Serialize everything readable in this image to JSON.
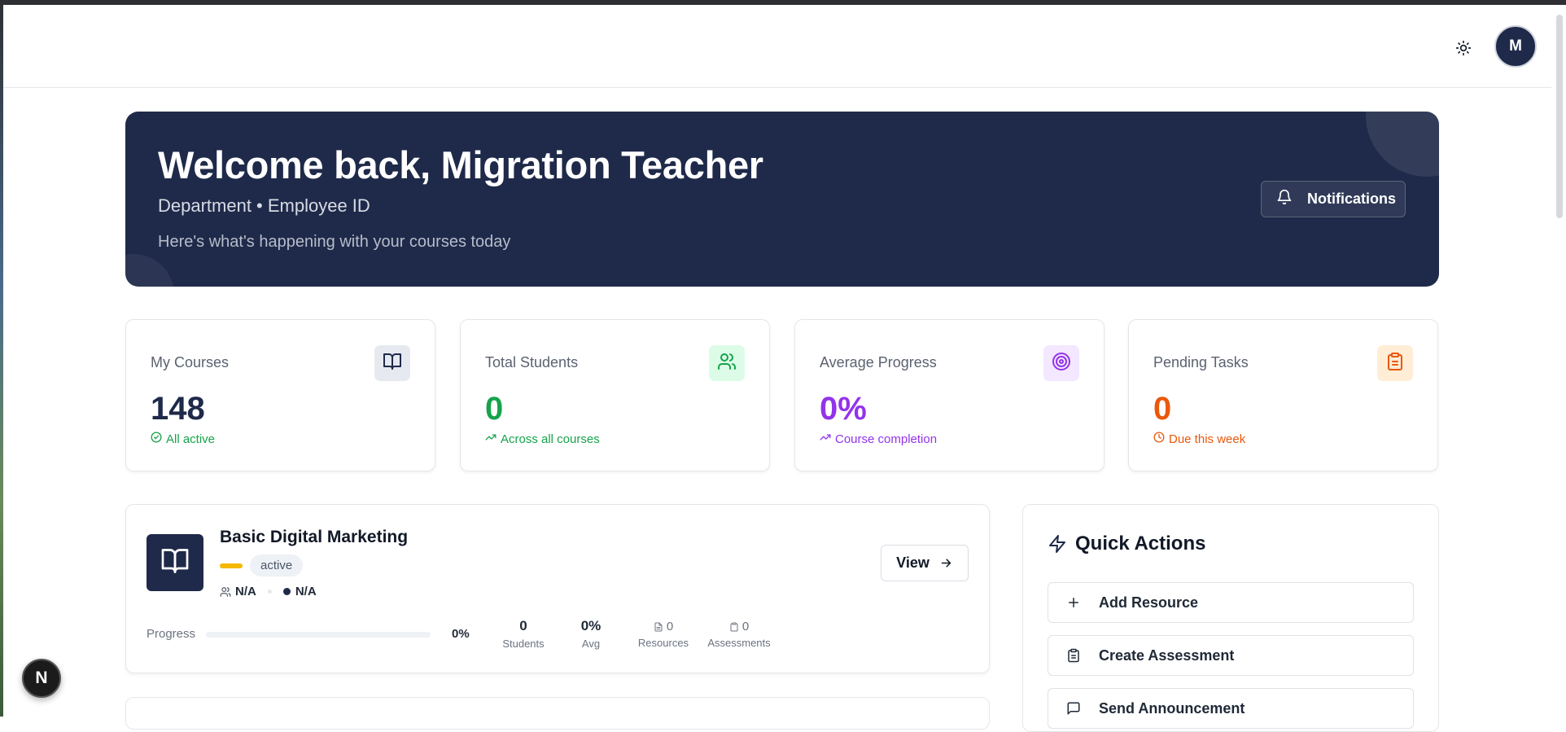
{
  "header": {
    "theme_icon": "sun-icon",
    "avatar_initial": "M"
  },
  "hero": {
    "title": "Welcome back, Migration Teacher",
    "subtitle": "Department • Employee ID",
    "tagline": "Here's what's happening with your courses today",
    "notifications_label": "Notifications",
    "colors": {
      "background": "#1f2a4a"
    }
  },
  "stats": [
    {
      "label": "My Courses",
      "value": "148",
      "note": "All active",
      "icon": "book-open-icon",
      "color": "#1f2a4a",
      "note_color": "#16a34a",
      "icon_bg": "#e6e9ef"
    },
    {
      "label": "Total Students",
      "value": "0",
      "note": "Across all courses",
      "icon": "users-icon",
      "color": "#16a34a",
      "note_color": "#16a34a",
      "icon_bg": "#dcfce7"
    },
    {
      "label": "Average Progress",
      "value": "0%",
      "note": "Course completion",
      "icon": "target-icon",
      "color": "#9333ea",
      "note_color": "#9333ea",
      "icon_bg": "#f3e8ff"
    },
    {
      "label": "Pending Tasks",
      "value": "0",
      "note": "Due this week",
      "icon": "clipboard-icon",
      "color": "#ea580c",
      "note_color": "#ea580c",
      "icon_bg": "#ffedd5"
    }
  ],
  "course": {
    "title": "Basic Digital Marketing",
    "status": "active",
    "meta_students": "N/A",
    "meta_level": "N/A",
    "view_label": "View",
    "progress_label": "Progress",
    "progress_value": "0%",
    "progress_fraction": 0,
    "students_value": "0",
    "students_label": "Students",
    "avg_value": "0%",
    "avg_label": "Avg",
    "resources_value": "0",
    "resources_label": "Resources",
    "assessments_value": "0",
    "assessments_label": "Assessments"
  },
  "quick_actions": {
    "title": "Quick Actions",
    "items": [
      {
        "label": "Add Resource",
        "icon": "plus-icon"
      },
      {
        "label": "Create Assessment",
        "icon": "clipboard-icon"
      },
      {
        "label": "Send Announcement",
        "icon": "message-square-icon"
      }
    ]
  },
  "dev_badge": {
    "label": "N"
  }
}
